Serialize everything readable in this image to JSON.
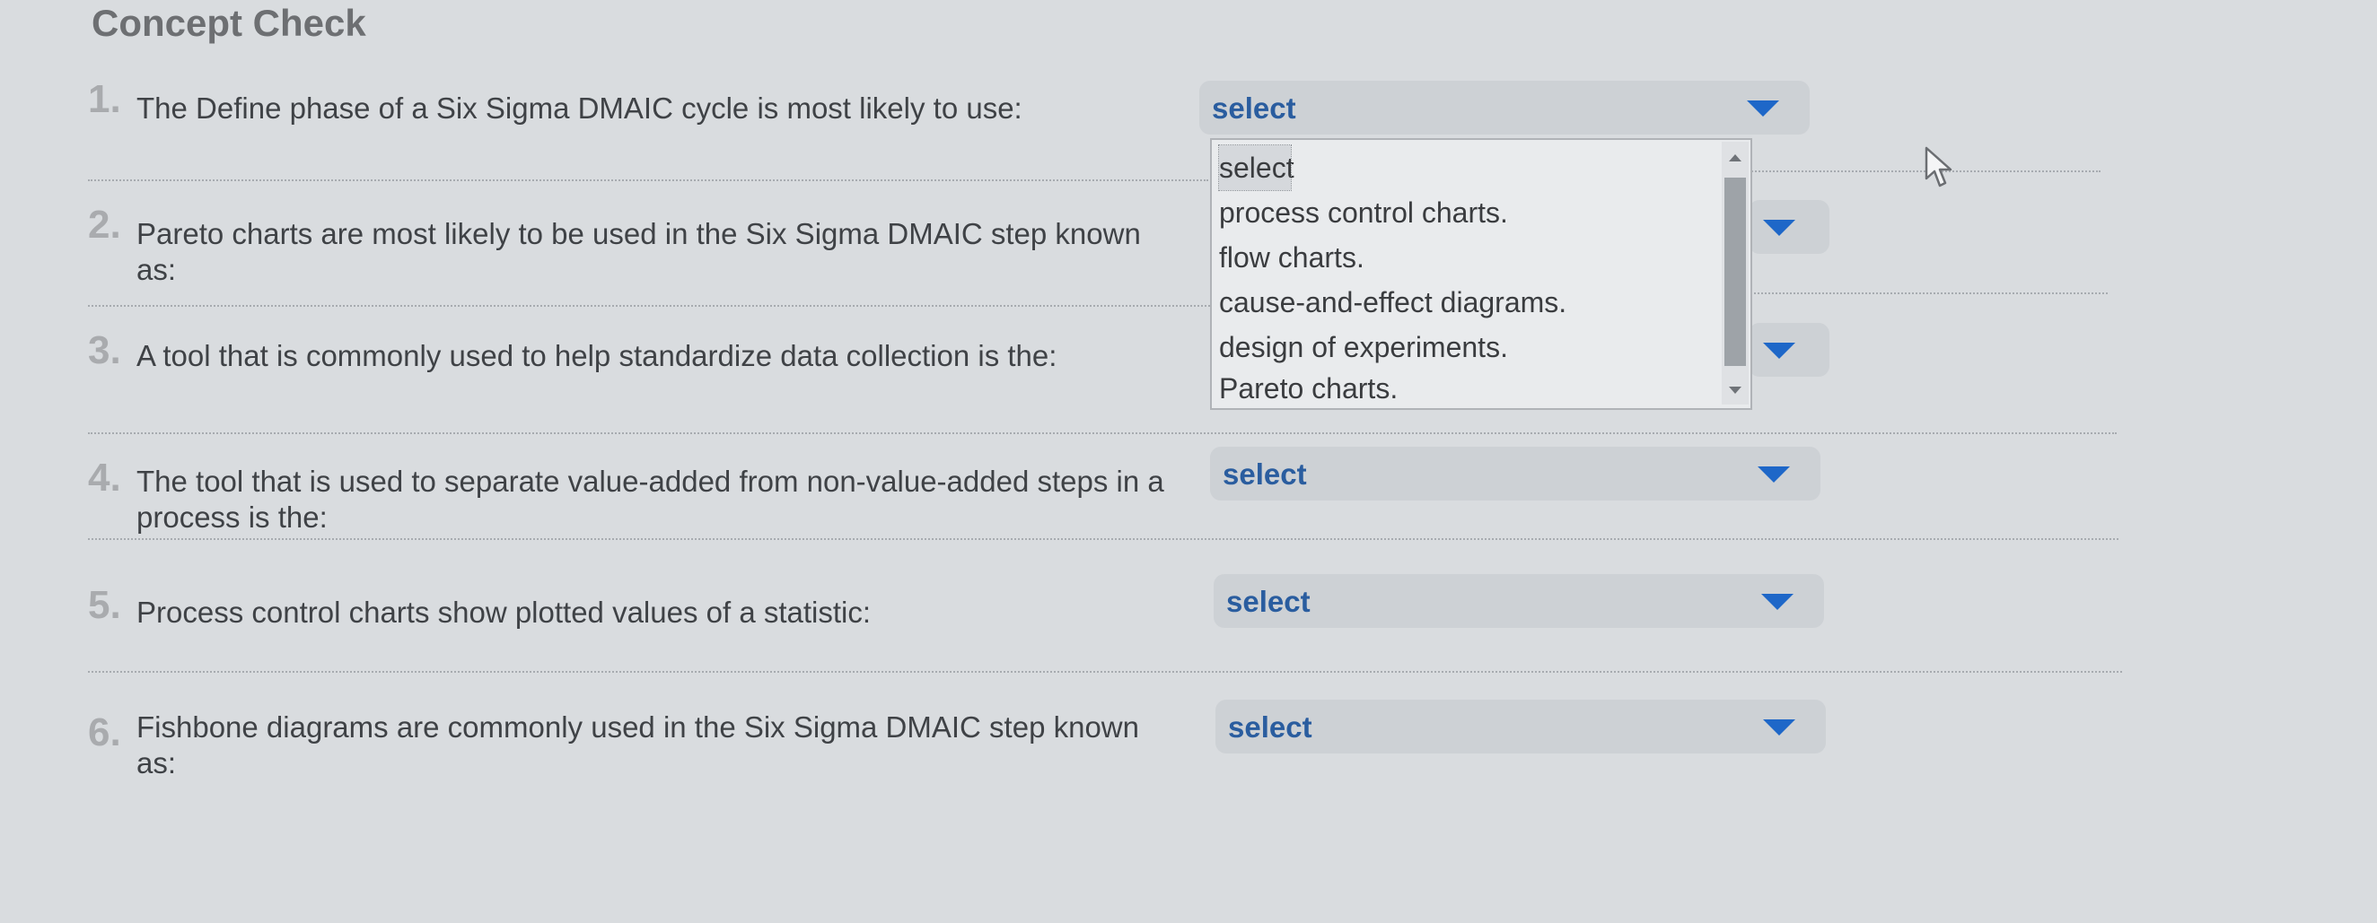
{
  "title": "Concept Check",
  "questions": [
    {
      "num": "1.",
      "text": "The Define phase of a Six Sigma DMAIC cycle is most likely to use:",
      "value": "select"
    },
    {
      "num": "2.",
      "text": "Pareto charts are most likely to be used in the Six Sigma DMAIC step known as:",
      "value": ""
    },
    {
      "num": "3.",
      "text": "A tool that is commonly used to help standardize data collection is the:",
      "value": ""
    },
    {
      "num": "4.",
      "text": "The tool that is used to separate value-added from non-value-added steps in a process is the:",
      "value": "select"
    },
    {
      "num": "5.",
      "text": "Process control charts show plotted values of a statistic:",
      "value": "select"
    },
    {
      "num": "6.",
      "text": "Fishbone diagrams are commonly used in the Six Sigma DMAIC step known as:",
      "value": "select"
    }
  ],
  "dropdown": {
    "options": [
      "select",
      "process control charts.",
      "flow charts.",
      "cause-and-effect diagrams.",
      "design of experiments.",
      "Pareto charts."
    ],
    "selected_index": 0
  },
  "colors": {
    "accent": "#1e67c8",
    "select_text": "#2a5d9f",
    "background": "#d9dcdf"
  },
  "icons": {
    "caret": "caret-down-icon",
    "cursor": "mouse-pointer-icon"
  }
}
